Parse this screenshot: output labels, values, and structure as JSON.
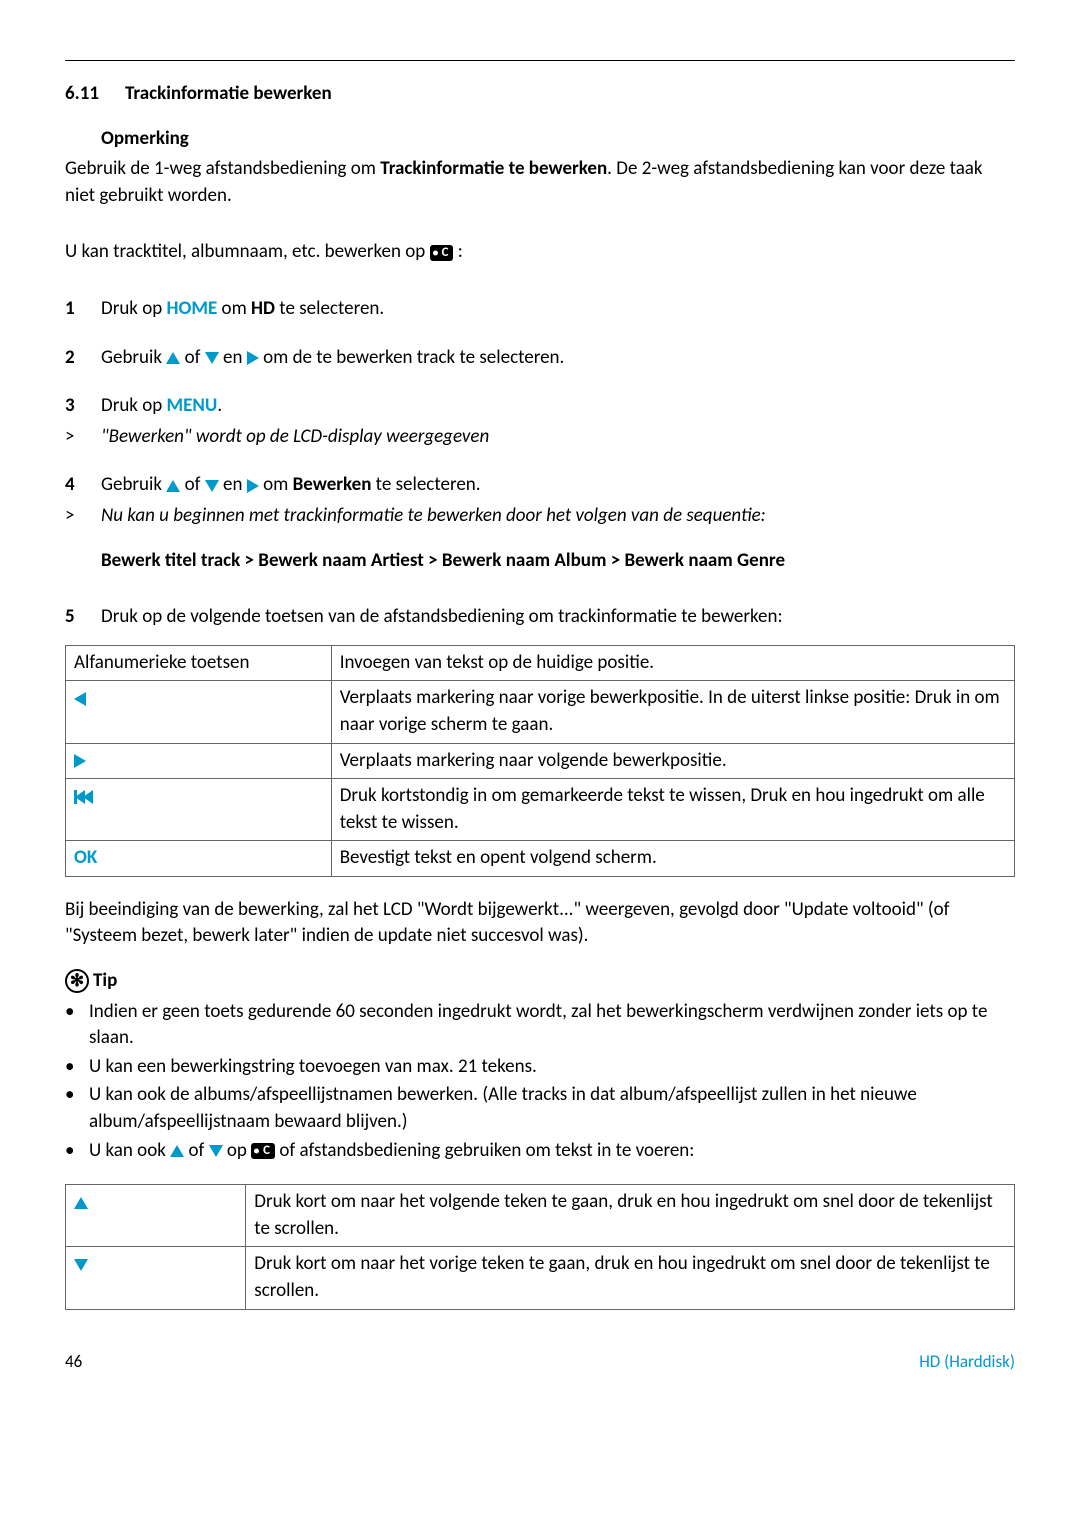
{
  "section": {
    "number": "6.11",
    "title": "Trackinformatie bewerken"
  },
  "note_heading": "Opmerking",
  "note_para_pre": "Gebruik de 1-weg afstandsbediening om ",
  "note_para_bold": "Trackinformatie te bewerken",
  "note_para_post": ". De 2-weg afstandsbediening kan voor deze taak niet gebruikt worden.",
  "intro_line": "U kan tracktitel, albumnaam, etc. bewerken op ",
  "intro_colon": ":",
  "steps": {
    "s1": {
      "num": "1",
      "pre": "Druk op ",
      "home": "HOME",
      "mid": " om ",
      "hd": "HD",
      "post": " te selecteren."
    },
    "s2": {
      "num": "2",
      "pre": "Gebruik ",
      "of": " of ",
      "en": " en ",
      "post": " om de te bewerken track te selecteren."
    },
    "s3": {
      "num": "3",
      "pre": "Druk op ",
      "menu": "MENU",
      "post": "."
    },
    "r3": {
      "gt": ">",
      "text": "\"Bewerken\" wordt op de LCD-display weergegeven"
    },
    "s4": {
      "num": "4",
      "pre": "Gebruik ",
      "of": " of ",
      "en": " en ",
      "mid": " om ",
      "bew": "Bewerken",
      "post": " te selecteren."
    },
    "r4": {
      "gt": ">",
      "text": "Nu kan u beginnen met trackinformatie te bewerken door het volgen van de sequentie:"
    },
    "seq": "Bewerk titel track > Bewerk naam Artiest > Bewerk naam Album > Bewerk naam Genre",
    "s5": {
      "num": "5",
      "text": "Druk op de volgende toetsen van de afstandsbediening om trackinformatie te bewerken:"
    }
  },
  "table1": {
    "r1c1": "Alfanumerieke toetsen",
    "r1c2": "Invoegen van tekst op de huidige positie.",
    "r2c2": "Verplaats markering naar vorige bewerkpositie. In de uiterst linkse positie: Druk in om naar vorige scherm te gaan.",
    "r3c2": "Verplaats markering naar volgende bewerkpositie.",
    "r4c2": "Druk kortstondig in om gemarkeerde tekst te wissen, Druk en hou ingedrukt om alle tekst te wissen.",
    "r5c1": "OK",
    "r5c2": "Bevestigt tekst en opent volgend scherm."
  },
  "after_table": "Bij beeindiging van de bewerking, zal het LCD \"Wordt bijgewerkt...\" weergeven, gevolgd door \"Update voltooid\" (of \"Systeem bezet, bewerk later\" indien de update niet succesvol was).",
  "tip_heading": "Tip",
  "tips": {
    "t1": "Indien er geen toets gedurende 60 seconden ingedrukt wordt, zal het bewerkingscherm verdwijnen zonder iets op te slaan.",
    "t2": "U kan een bewerkingstring toevoegen van max. 21 tekens.",
    "t3": "U kan ook de albums/afspeellijstnamen bewerken. (Alle tracks in dat album/afspeellijst zullen in het nieuwe album/afspeellijstnaam bewaard blijven.)",
    "t4_pre": "U kan ook ",
    "t4_of": " of ",
    "t4_op": " op ",
    "t4_post": " of afstandsbediening gebruiken om tekst in te voeren:"
  },
  "table2": {
    "r1c2": "Druk kort om naar het volgende teken te gaan, druk en hou ingedrukt om snel door de tekenlijst te scrollen.",
    "r2c2": "Druk kort om naar het vorige teken te gaan, druk en hou ingedrukt om snel door de tekenlijst te scrollen."
  },
  "footer": {
    "page": "46",
    "chapter": "HD (Harddisk)"
  },
  "badge_c": "C"
}
